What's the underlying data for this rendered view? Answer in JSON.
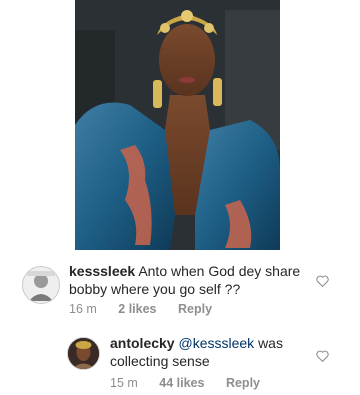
{
  "comments": [
    {
      "username": "kesssleek",
      "text": "Anto when  God dey share bobby where you go self ??",
      "time": "16 m",
      "likes": "2 likes",
      "reply": "Reply"
    },
    {
      "username": "antolecky",
      "mention": "@kesssleek",
      "text": "was collecting sense",
      "time": "15 m",
      "likes": "44 likes",
      "reply": "Reply"
    }
  ],
  "icons": {
    "like": "heart-icon"
  }
}
